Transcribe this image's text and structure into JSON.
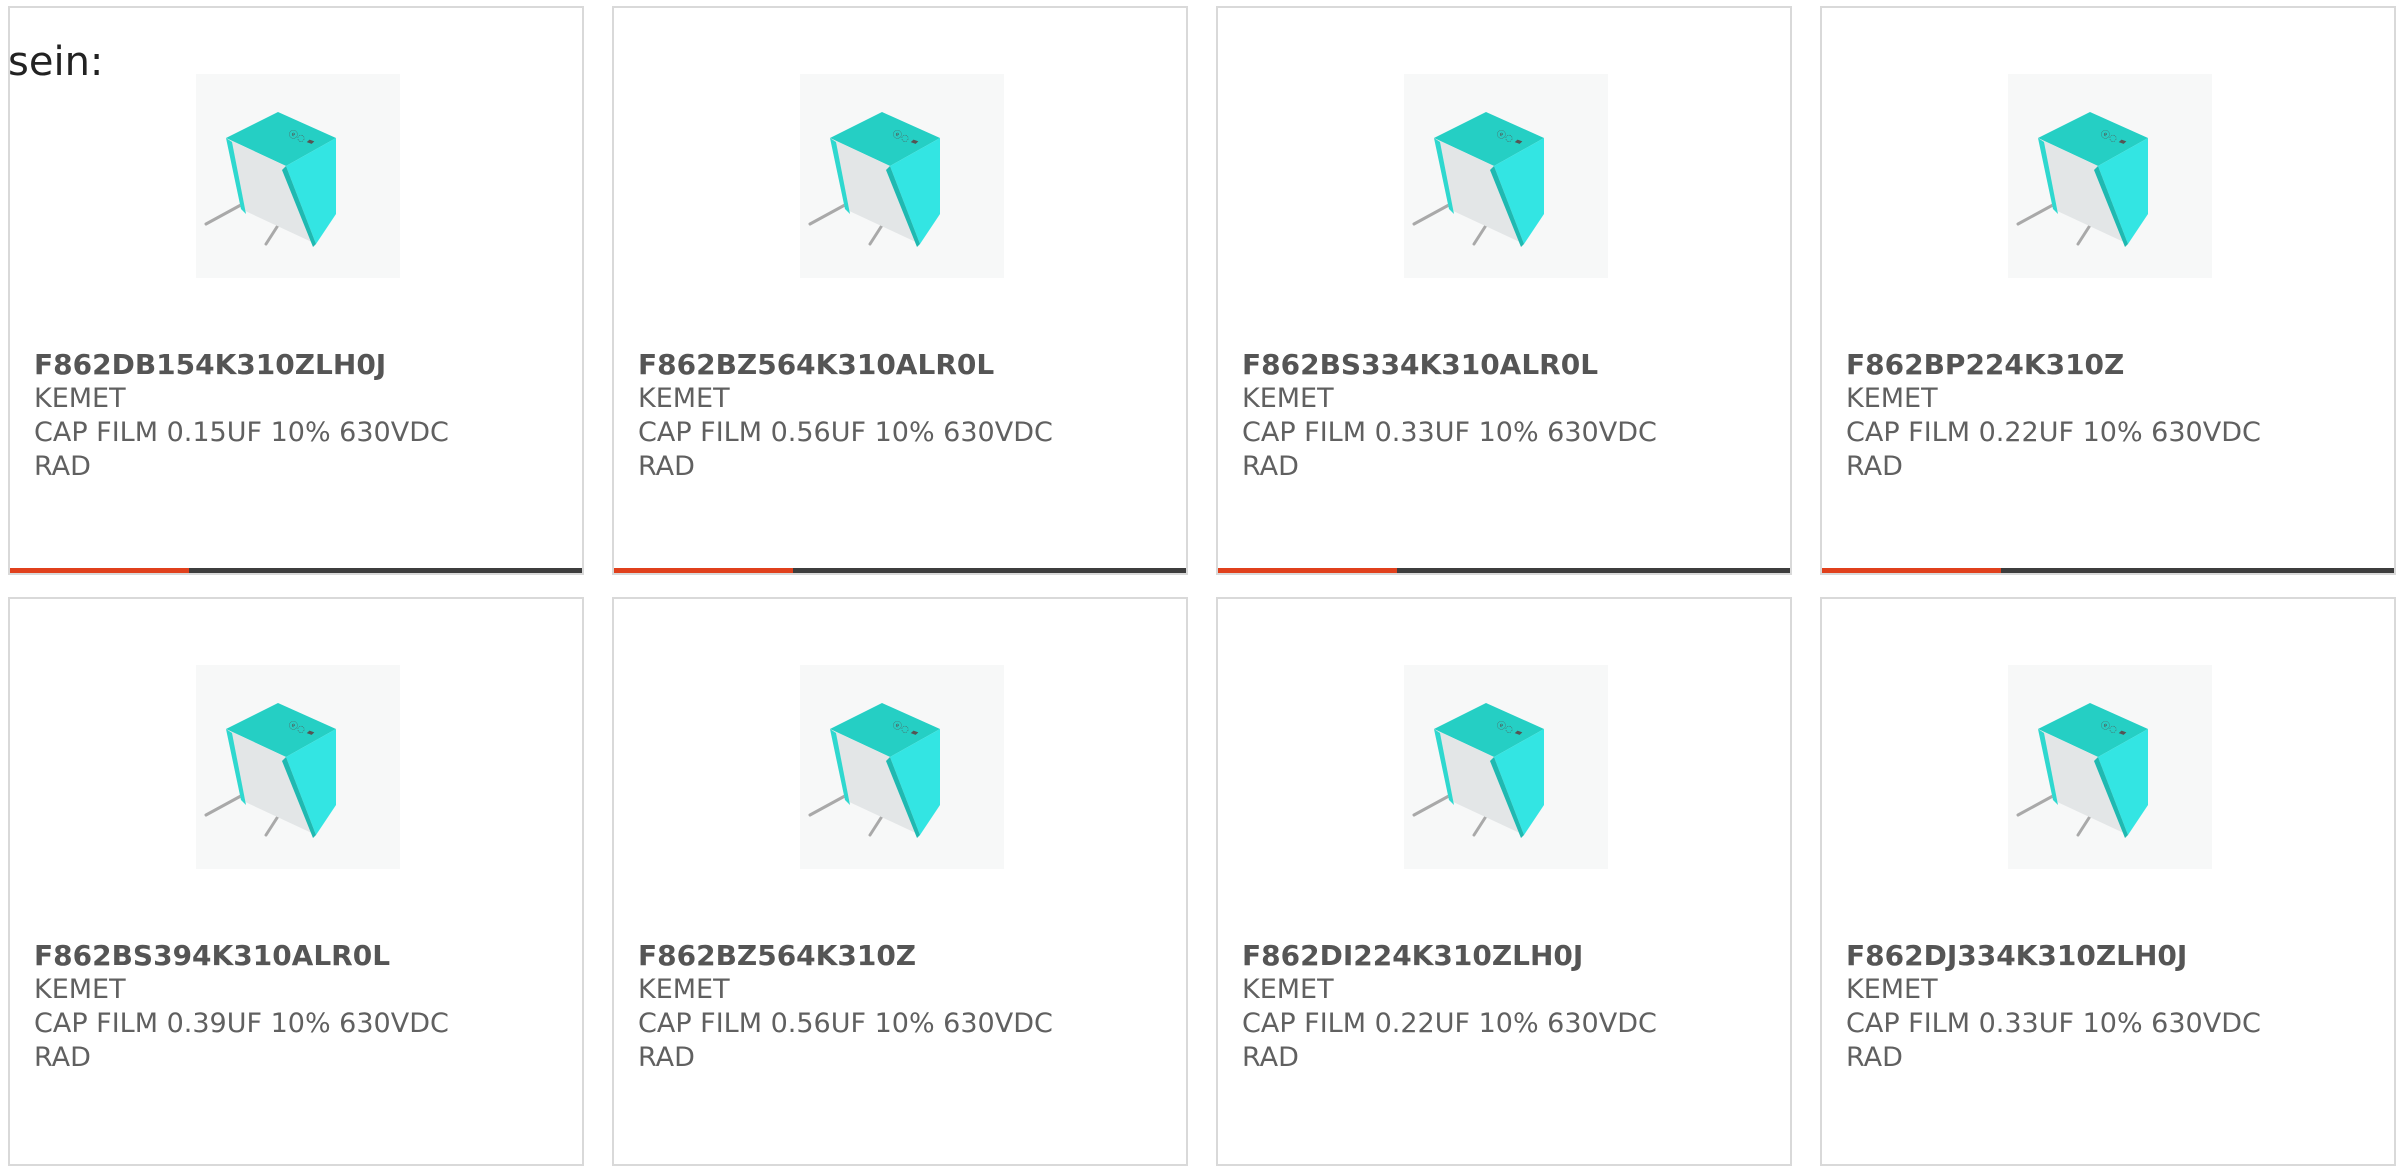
{
  "intro_text": "sein:",
  "colors": {
    "card_border": "#d9d9d9",
    "text": "#606060",
    "bar_accent": "#e0401c",
    "bar_track": "#3d3d3d",
    "capacitor_body": "#2fd8cf"
  },
  "products": [
    {
      "part_number": "F862DB154K310ZLH0J",
      "manufacturer": "KEMET",
      "description_line1": "CAP FILM 0.15UF 10% 630VDC",
      "description_line2": "RAD",
      "image_icon": "film-capacitor-image",
      "progress": 0.31
    },
    {
      "part_number": "F862BZ564K310ALR0L",
      "manufacturer": "KEMET",
      "description_line1": "CAP FILM 0.56UF 10% 630VDC",
      "description_line2": "RAD",
      "image_icon": "film-capacitor-image",
      "progress": 0.31
    },
    {
      "part_number": "F862BS334K310ALR0L",
      "manufacturer": "KEMET",
      "description_line1": "CAP FILM 0.33UF 10% 630VDC",
      "description_line2": "RAD",
      "image_icon": "film-capacitor-image",
      "progress": 0.31
    },
    {
      "part_number": "F862BP224K310Z",
      "manufacturer": "KEMET",
      "description_line1": "CAP FILM 0.22UF 10% 630VDC",
      "description_line2": "RAD",
      "image_icon": "film-capacitor-image",
      "progress": 0.31
    },
    {
      "part_number": "F862BS394K310ALR0L",
      "manufacturer": "KEMET",
      "description_line1": "CAP FILM 0.39UF 10% 630VDC",
      "description_line2": "RAD",
      "image_icon": "film-capacitor-image"
    },
    {
      "part_number": "F862BZ564K310Z",
      "manufacturer": "KEMET",
      "description_line1": "CAP FILM 0.56UF 10% 630VDC",
      "description_line2": "RAD",
      "image_icon": "film-capacitor-image"
    },
    {
      "part_number": "F862DI224K310ZLH0J",
      "manufacturer": "KEMET",
      "description_line1": "CAP FILM 0.22UF 10% 630VDC",
      "description_line2": "RAD",
      "image_icon": "film-capacitor-image"
    },
    {
      "part_number": "F862DJ334K310ZLH0J",
      "manufacturer": "KEMET",
      "description_line1": "CAP FILM 0.33UF 10% 630VDC",
      "description_line2": "RAD",
      "image_icon": "film-capacitor-image"
    }
  ]
}
